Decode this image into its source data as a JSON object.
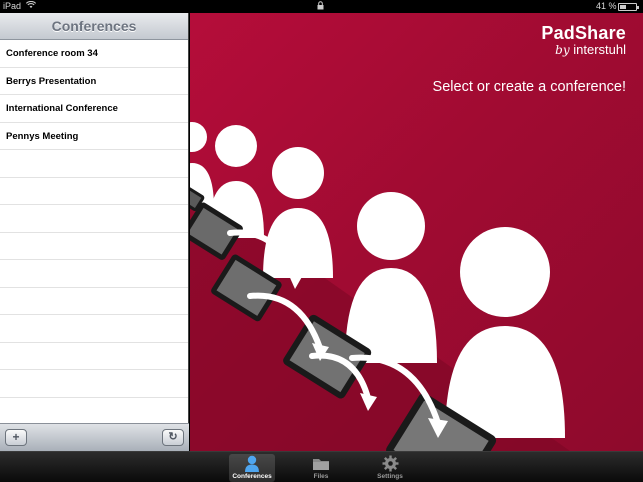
{
  "status_bar": {
    "carrier": "iPad",
    "battery": "41 %",
    "battery_level": 0.41
  },
  "master": {
    "title": "Conferences",
    "conferences": [
      "Conference room 34",
      "Berrys Presentation",
      "International Conference",
      "Pennys Meeting"
    ],
    "empty_rows": 10
  },
  "detail": {
    "logo_name": "PadShare",
    "logo_by": "by",
    "logo_company": "interstuhl",
    "prompt": "Select or create a conference!"
  },
  "tabs": [
    {
      "label": "Conferences",
      "icon": "person-icon",
      "active": true
    },
    {
      "label": "Files",
      "icon": "folder-icon",
      "active": false
    },
    {
      "label": "Settings",
      "icon": "gear-icon",
      "active": false
    }
  ],
  "colors": {
    "brand_red": "#a50c34",
    "tab_active_blue": "#4fa6f0"
  }
}
